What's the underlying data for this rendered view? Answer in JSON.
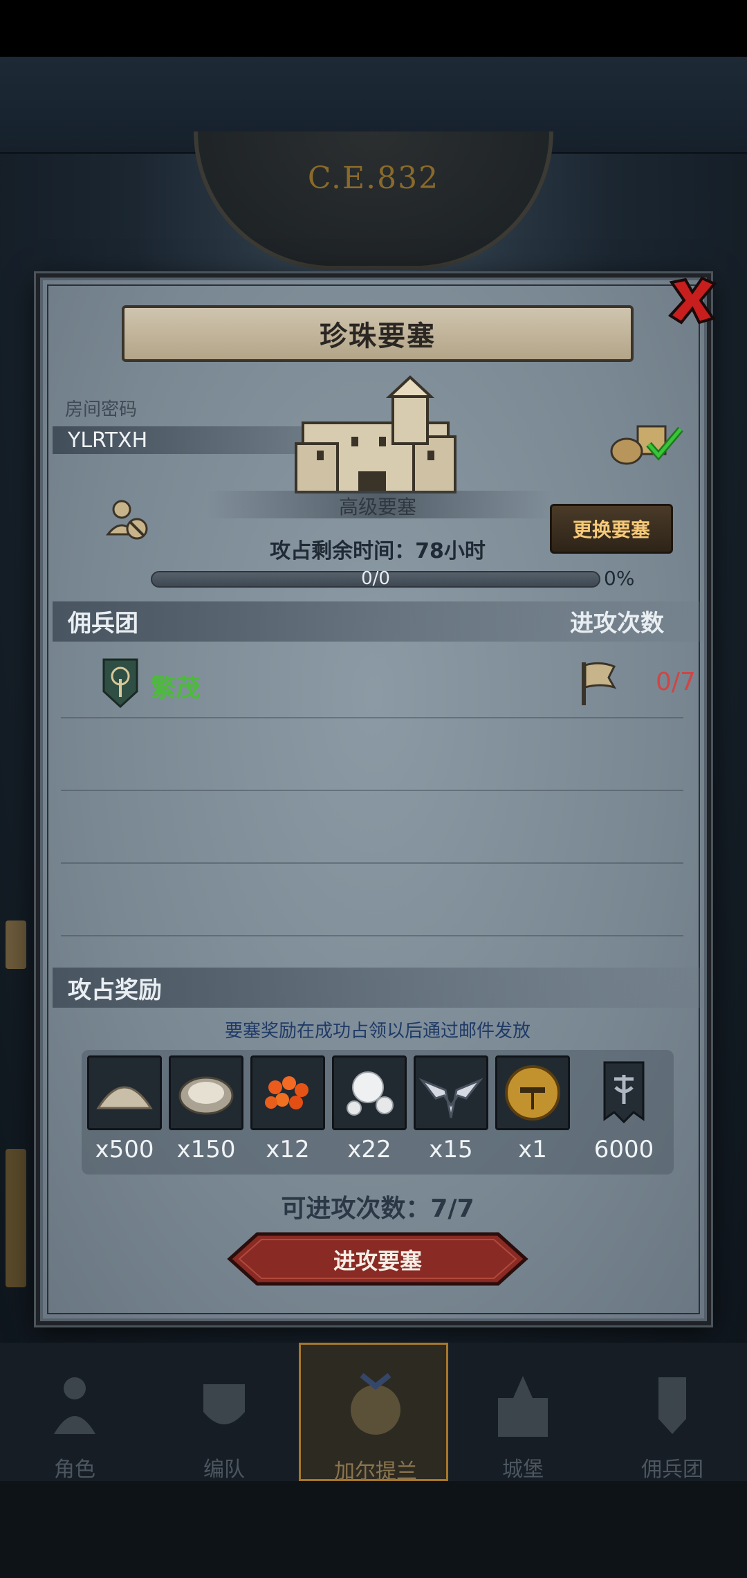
{
  "background": {
    "era": "C.E.832"
  },
  "dialog": {
    "title": "珍珠要塞",
    "room_label": "房间密码",
    "room_code": "YLRTXH",
    "fortress_name": "高级要塞",
    "change_button": "更换要塞",
    "remaining_time": "攻占剩余时间：78小时",
    "progress": {
      "text": "0/0",
      "percent_label": "0%",
      "value": 0
    },
    "mercenary_header": "佣兵团",
    "attack_count_header": "进攻次数",
    "guilds": [
      {
        "name": "繁茂",
        "attacks": "0/7"
      }
    ],
    "rewards_header": "攻占奖励",
    "rewards_note": "要塞奖励在成功占领以后通过邮件发放",
    "rewards": [
      {
        "icon": "sand-pile-icon",
        "qty": "x500"
      },
      {
        "icon": "oyster-icon",
        "qty": "x150"
      },
      {
        "icon": "fish-roe-icon",
        "qty": "x12"
      },
      {
        "icon": "pearl-icon",
        "qty": "x22"
      },
      {
        "icon": "winged-crest-icon",
        "qty": "x15"
      },
      {
        "icon": "golden-helmet-icon",
        "qty": "x1"
      },
      {
        "icon": "war-banner-icon",
        "qty": "6000"
      }
    ],
    "available_attacks": "可进攻次数：7/7",
    "attack_button": "进攻要塞"
  },
  "nav": [
    {
      "label": "角色",
      "icon": "character-icon",
      "active": false
    },
    {
      "label": "编队",
      "icon": "formation-icon",
      "active": false
    },
    {
      "label": "加尔提兰",
      "icon": "world-icon",
      "active": true
    },
    {
      "label": "城堡",
      "icon": "castle-icon",
      "active": false
    },
    {
      "label": "佣兵团",
      "icon": "mercenary-icon",
      "active": false
    }
  ],
  "colors": {
    "accent_gold": "#f5c978",
    "guild_green": "#4cbb3a",
    "attack_red": "#d04545",
    "note_blue": "#1f3a66"
  }
}
